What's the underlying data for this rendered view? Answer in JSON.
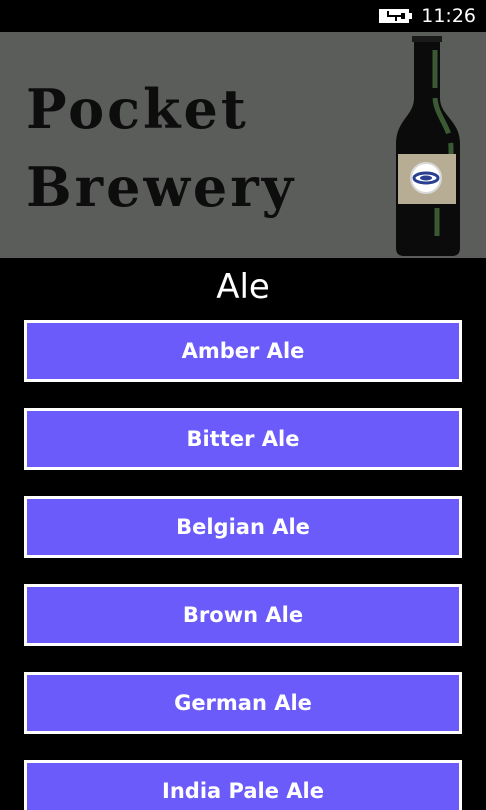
{
  "status_bar": {
    "time": "11:26",
    "battery_icon": "battery-charging-icon"
  },
  "banner": {
    "title_line1": "Pocket",
    "title_line2": "Brewery",
    "bottle_icon": "beer-bottle-icon",
    "background_color": "#5b5d5a"
  },
  "category": {
    "title": "Ale"
  },
  "beers": [
    {
      "label": "Amber Ale"
    },
    {
      "label": "Bitter Ale"
    },
    {
      "label": "Belgian Ale"
    },
    {
      "label": "Brown Ale"
    },
    {
      "label": "German Ale"
    },
    {
      "label": "India Pale Ale"
    }
  ],
  "colors": {
    "button_fill": "#6a5bfa",
    "button_border": "#ffffff",
    "background": "#000000",
    "text": "#ffffff"
  }
}
